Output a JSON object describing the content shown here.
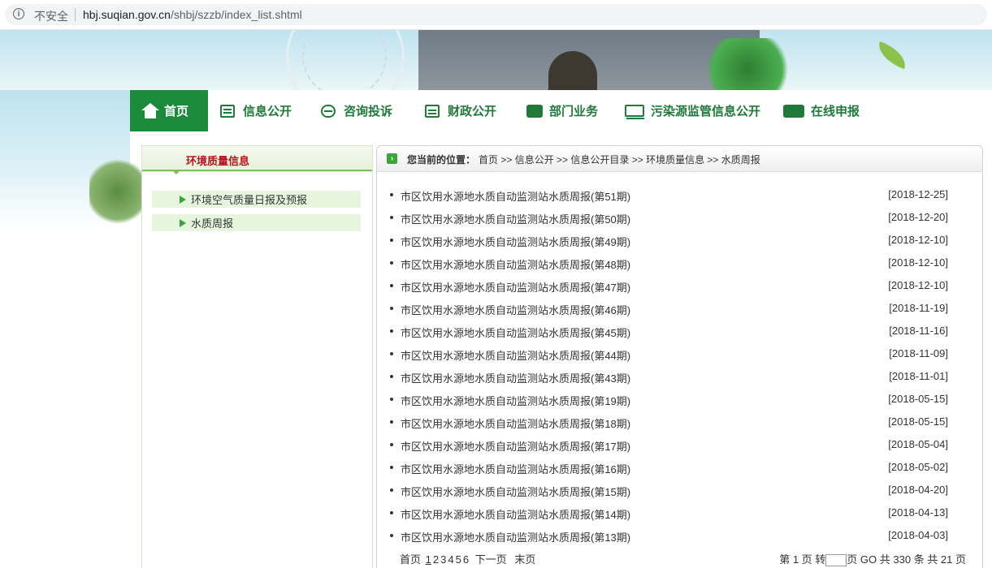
{
  "browser": {
    "security_label": "不安全",
    "url_host": "hbj.suqian.gov.cn",
    "url_path": "/shbj/szzb/index_list.shtml"
  },
  "nav": {
    "items": [
      {
        "label": "首页",
        "icon": "home-icon"
      },
      {
        "label": "信息公开",
        "icon": "document-edit-icon"
      },
      {
        "label": "咨询投诉",
        "icon": "chat-bubble-icon"
      },
      {
        "label": "财政公开",
        "icon": "clipboard-icon"
      },
      {
        "label": "部门业务",
        "icon": "notebook-pen-icon"
      },
      {
        "label": "污染源监管信息公开",
        "icon": "monitor-icon"
      },
      {
        "label": "在线申报",
        "icon": "computer-icon"
      }
    ]
  },
  "sidebar": {
    "title": "环境质量信息",
    "items": [
      {
        "label": "环境空气质量日报及预报"
      },
      {
        "label": "水质周报"
      }
    ]
  },
  "breadcrumb": {
    "prefix": "您当前的位置：",
    "path": "首页 >> 信息公开 >> 信息公开目录 >> 环境质量信息 >> 水质周报"
  },
  "articles": [
    {
      "title": "市区饮用水源地水质自动监测站水质周报(第51期)",
      "date": "[2018-12-25]"
    },
    {
      "title": "市区饮用水源地水质自动监测站水质周报(第50期)",
      "date": "[2018-12-20]"
    },
    {
      "title": "市区饮用水源地水质自动监测站水质周报(第49期)",
      "date": "[2018-12-10]"
    },
    {
      "title": "市区饮用水源地水质自动监测站水质周报(第48期)",
      "date": "[2018-12-10]"
    },
    {
      "title": "市区饮用水源地水质自动监测站水质周报(第47期)",
      "date": "[2018-12-10]"
    },
    {
      "title": "市区饮用水源地水质自动监测站水质周报(第46期)",
      "date": "[2018-11-19]"
    },
    {
      "title": "市区饮用水源地水质自动监测站水质周报(第45期)",
      "date": "[2018-11-16]"
    },
    {
      "title": "市区饮用水源地水质自动监测站水质周报(第44期)",
      "date": "[2018-11-09]"
    },
    {
      "title": "市区饮用水源地水质自动监测站水质周报(第43期)",
      "date": "[2018-11-01]"
    },
    {
      "title": "市区饮用水源地水质自动监测站水质周报(第19期)",
      "date": "[2018-05-15]"
    },
    {
      "title": "市区饮用水源地水质自动监测站水质周报(第18期)",
      "date": "[2018-05-15]"
    },
    {
      "title": "市区饮用水源地水质自动监测站水质周报(第17期)",
      "date": "[2018-05-04]"
    },
    {
      "title": "市区饮用水源地水质自动监测站水质周报(第16期)",
      "date": "[2018-05-02]"
    },
    {
      "title": "市区饮用水源地水质自动监测站水质周报(第15期)",
      "date": "[2018-04-20]"
    },
    {
      "title": "市区饮用水源地水质自动监测站水质周报(第14期)",
      "date": "[2018-04-13]"
    },
    {
      "title": "市区饮用水源地水质自动监测站水质周报(第13期)",
      "date": "[2018-04-03]"
    }
  ],
  "pager": {
    "first": "首页",
    "pages": [
      "1",
      "2",
      "3",
      "4",
      "5",
      "6"
    ],
    "current": "1",
    "next": "下一页",
    "last": "末页",
    "info_prefix": "第 1 页 转",
    "info_mid": "页",
    "go": "GO",
    "info_suffix": "共 330 条 共 21 页"
  },
  "colors": {
    "nav_green": "#1b8a3b",
    "nav_text": "#1f7a3a",
    "side_title_red": "#b5121b",
    "side_item_bg": "#e7f5df",
    "accent_green": "#3aa63a"
  }
}
